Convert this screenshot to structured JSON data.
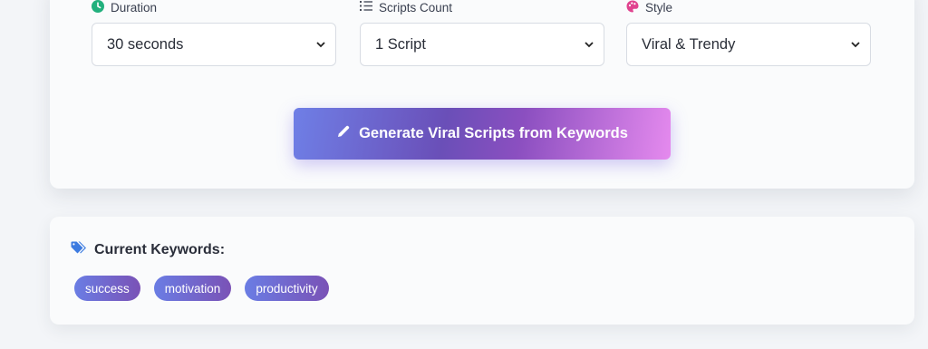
{
  "options": {
    "duration": {
      "label": "Duration",
      "value": "30 seconds",
      "icon": "clock-icon",
      "icon_color": "#22b07d"
    },
    "scripts_count": {
      "label": "Scripts Count",
      "value": "1 Script",
      "icon": "numbered-list-icon",
      "icon_color": "#4a4f5c"
    },
    "style": {
      "label": "Style",
      "value": "Viral & Trendy",
      "icon": "palette-icon",
      "icon_color": "#e0438f"
    }
  },
  "generate_button": {
    "label": "Generate Viral Scripts from Keywords",
    "icon": "pencil-icon"
  },
  "keywords": {
    "heading": "Current Keywords:",
    "icon": "tags-icon",
    "icon_color": "#3c7be0",
    "items": [
      "success",
      "motivation",
      "productivity"
    ]
  },
  "colors": {
    "accent_start": "#6f7fe6",
    "accent_mid": "#6a4fb8",
    "accent_end": "#e58aee"
  }
}
